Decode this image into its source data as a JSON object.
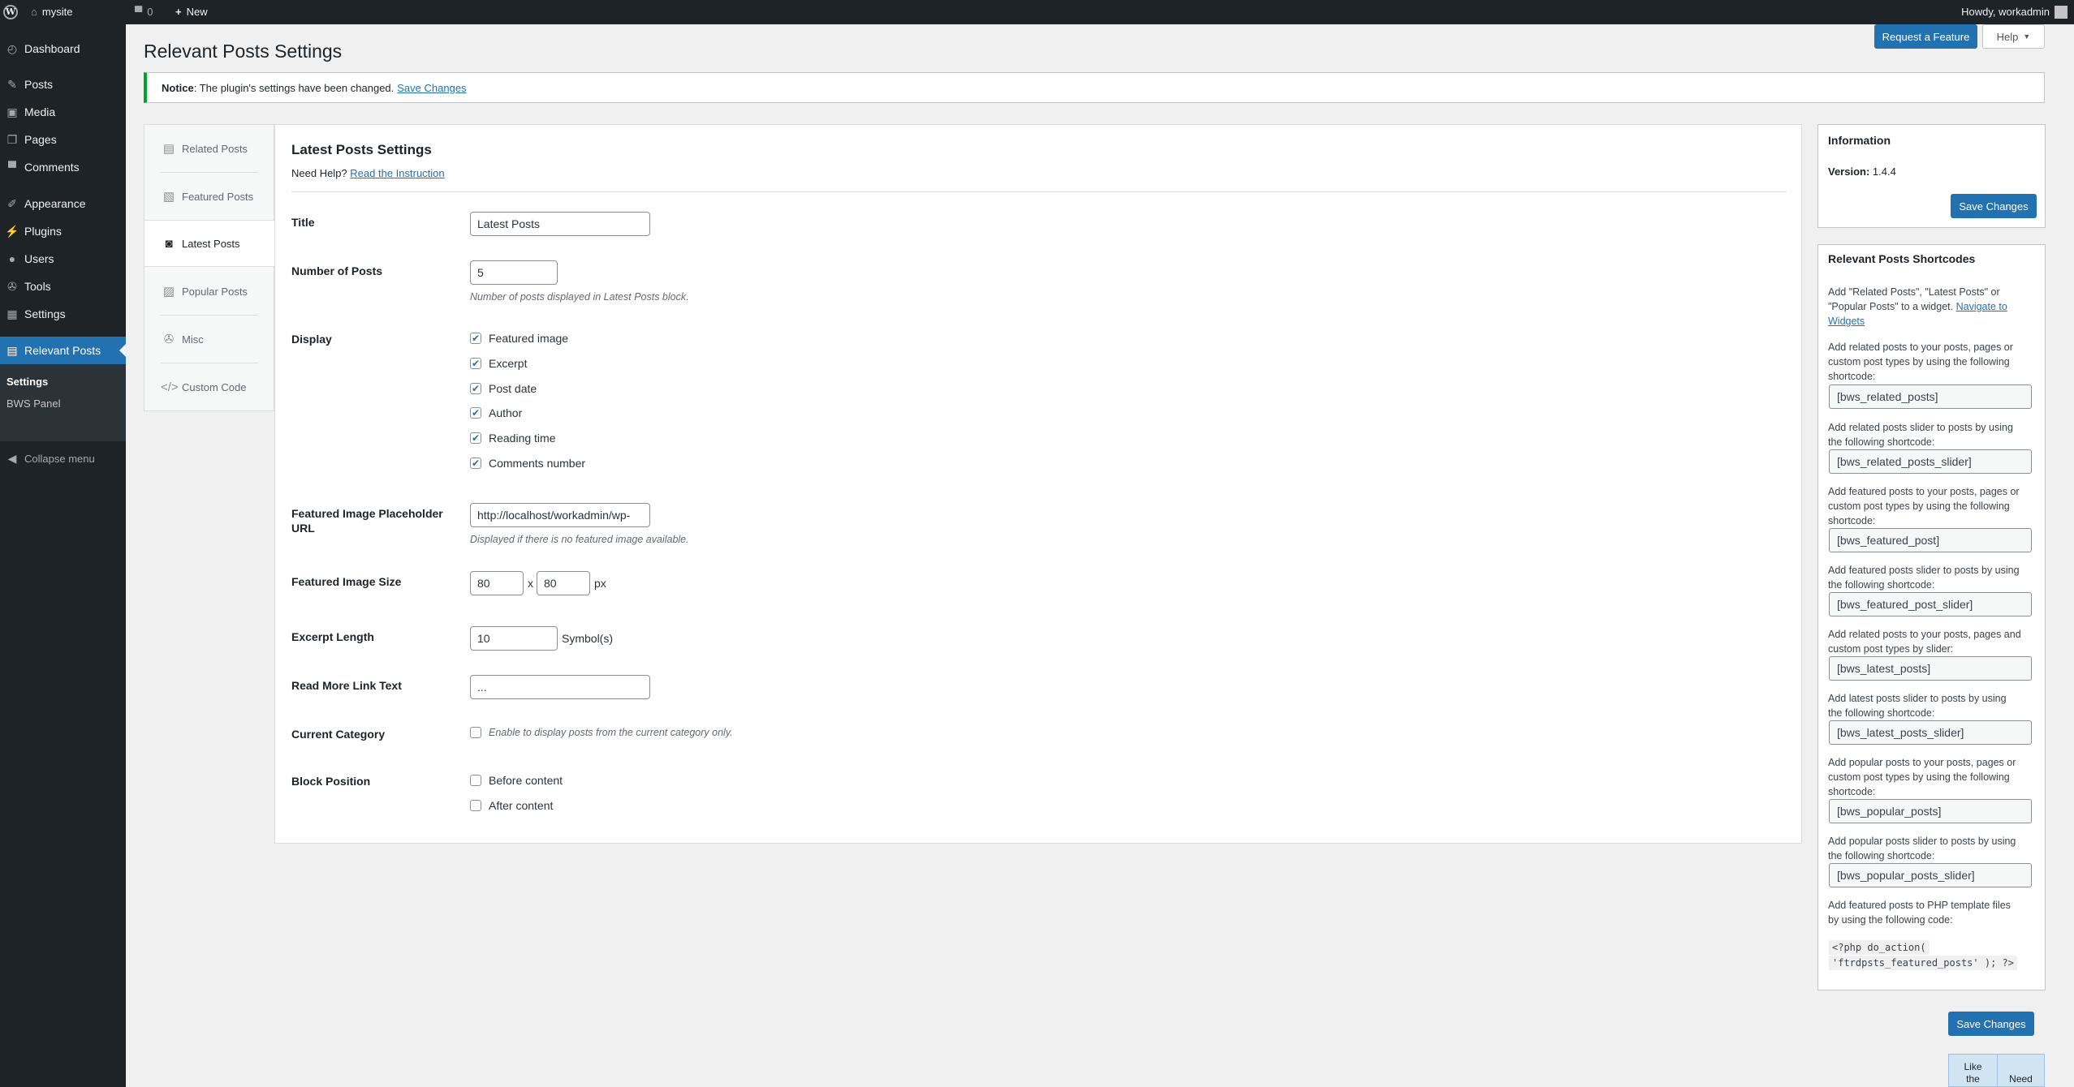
{
  "adminbar": {
    "site_name": "mysite",
    "comments_count": "0",
    "new_label": "New",
    "howdy": "Howdy, workadmin"
  },
  "sidebar": {
    "items": [
      {
        "label": "Dashboard"
      },
      {
        "label": "Posts"
      },
      {
        "label": "Media"
      },
      {
        "label": "Pages"
      },
      {
        "label": "Comments"
      },
      {
        "label": "Appearance"
      },
      {
        "label": "Plugins"
      },
      {
        "label": "Users"
      },
      {
        "label": "Tools"
      },
      {
        "label": "Settings"
      },
      {
        "label": "Relevant Posts"
      }
    ],
    "submenu": [
      "Settings",
      "BWS Panel"
    ],
    "collapse": "Collapse menu"
  },
  "header": {
    "title": "Relevant Posts Settings",
    "request_feature": "Request a Feature",
    "help": "Help"
  },
  "notice": {
    "strong": "Notice",
    "text": ": The plugin's settings have been changed.",
    "link": "Save Changes"
  },
  "tabs": [
    "Related Posts",
    "Featured Posts",
    "Latest Posts",
    "Popular Posts",
    "Misc",
    "Custom Code"
  ],
  "settings": {
    "heading": "Latest Posts Settings",
    "need_help": "Need Help?",
    "instruction_link": "Read the Instruction",
    "title_label": "Title",
    "title_value": "Latest Posts",
    "num_label": "Number of Posts",
    "num_value": "5",
    "num_desc": "Number of posts displayed in Latest Posts block.",
    "display_label": "Display",
    "display_options": [
      {
        "label": "Featured image",
        "checked": true
      },
      {
        "label": "Excerpt",
        "checked": true
      },
      {
        "label": "Post date",
        "checked": true
      },
      {
        "label": "Author",
        "checked": true
      },
      {
        "label": "Reading time",
        "checked": true
      },
      {
        "label": "Comments number",
        "checked": true
      }
    ],
    "placeholder_label_1": "Featured Image Placeholder",
    "placeholder_label_2": "URL",
    "placeholder_value": "http://localhost/workadmin/wp-",
    "placeholder_desc": "Displayed if there is no featured image available.",
    "size_label": "Featured Image Size",
    "width": "80",
    "x": "x",
    "height": "80",
    "px": "px",
    "excerpt_label": "Excerpt Length",
    "excerpt_value": "10",
    "symbols": "Symbol(s)",
    "readmore_label": "Read More Link Text",
    "readmore_value": "...",
    "category_label": "Current Category",
    "category_desc": "Enable to display posts from the current category only.",
    "position_label": "Block Position",
    "position_options": [
      {
        "label": "Before content",
        "checked": false
      },
      {
        "label": "After content",
        "checked": false
      }
    ]
  },
  "info": {
    "title": "Information",
    "version_label": "Version:",
    "version": "1.4.4",
    "save": "Save Changes"
  },
  "shortcodes": {
    "title": "Relevant Posts Shortcodes",
    "intro_1": "Add \"Related Posts\", \"Latest Posts\" or",
    "intro_2": "\"Popular Posts\" to a widget.",
    "navigate_1": "Navigate to",
    "navigate_2": "Widgets",
    "items": [
      {
        "desc": [
          "Add related posts to your posts, pages or",
          "custom post types by using the following",
          "shortcode:"
        ],
        "code": "[bws_related_posts]"
      },
      {
        "desc": [
          "Add related posts slider to posts by using",
          "the following shortcode:"
        ],
        "code": "[bws_related_posts_slider]"
      },
      {
        "desc": [
          "Add featured posts to your posts, pages or",
          "custom post types by using the following",
          "shortcode:"
        ],
        "code": "[bws_featured_post]"
      },
      {
        "desc": [
          "Add featured posts slider to posts by using",
          "the following shortcode:"
        ],
        "code": "[bws_featured_post_slider]"
      },
      {
        "desc": [
          "Add related posts to your posts, pages and",
          "custom post types by slider:"
        ],
        "code": "[bws_latest_posts]"
      },
      {
        "desc": [
          "Add latest posts slider to posts by using",
          "the following shortcode:"
        ],
        "code": "[bws_latest_posts_slider]"
      },
      {
        "desc": [
          "Add popular posts to your posts, pages or",
          "custom post types by using the following",
          "shortcode:"
        ],
        "code": "[bws_popular_posts]"
      },
      {
        "desc": [
          "Add popular posts slider to posts by using",
          "the following shortcode:"
        ],
        "code": "[bws_popular_posts_slider]"
      }
    ],
    "php_desc": [
      "Add featured posts to PHP template files",
      "by using the following code:"
    ],
    "php_code_1": "<?php do_action(",
    "php_code_2": "'ftrdpsts_featured_posts' ); ?>"
  },
  "bottom": {
    "save": "Save Changes",
    "like": [
      "Like",
      "the"
    ],
    "need": "Need"
  }
}
